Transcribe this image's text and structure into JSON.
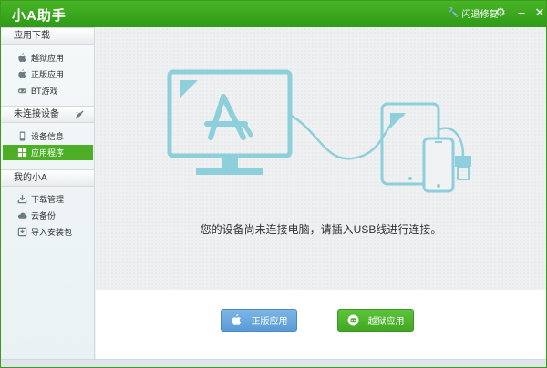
{
  "app": {
    "title": "小A助手"
  },
  "titlebar": {
    "flash_label": "闪退修复"
  },
  "sidebar": {
    "sections": [
      {
        "title": "应用下载",
        "items": [
          {
            "label": "越狱应用",
            "icon": "apple-icon"
          },
          {
            "label": "正版应用",
            "icon": "apple-icon"
          },
          {
            "label": "BT游戏",
            "icon": "gamepad-icon"
          }
        ]
      },
      {
        "title": "未连接设备",
        "items": [
          {
            "label": "设备信息",
            "icon": "phone-icon"
          },
          {
            "label": "应用程序",
            "icon": "grid-icon",
            "active": true
          }
        ]
      },
      {
        "title": "我的小A",
        "items": [
          {
            "label": "下载管理",
            "icon": "download-icon"
          },
          {
            "label": "云备份",
            "icon": "cloud-icon"
          },
          {
            "label": "导入安装包",
            "icon": "import-icon"
          }
        ]
      }
    ]
  },
  "main": {
    "message": "您的设备尚未连接电脑，请插入USB线进行连接。",
    "buttons": {
      "official": "正版应用",
      "jailbreak": "越狱应用"
    }
  },
  "colors": {
    "brand": "#3aa51c",
    "active": "#4caf25",
    "illustration": "#8ecfdc",
    "official_btn": "#6aa8de"
  }
}
